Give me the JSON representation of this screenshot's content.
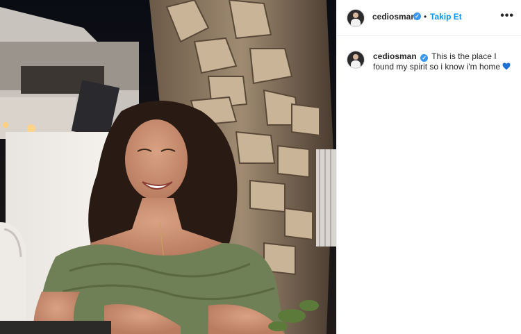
{
  "post": {
    "header": {
      "username": "cediosman",
      "separator": "•",
      "follow_label": "Takip Et",
      "more_label": "•••"
    },
    "caption": {
      "username": "cediosman",
      "text": "This is the place I found my spirit so i know i'm home"
    },
    "colors": {
      "follow": "#0095f6",
      "verified": "#3897f0",
      "heart": "#1f6fd6"
    },
    "icons": [
      "verified-badge-icon",
      "more-options-icon",
      "blue-heart-icon"
    ]
  }
}
